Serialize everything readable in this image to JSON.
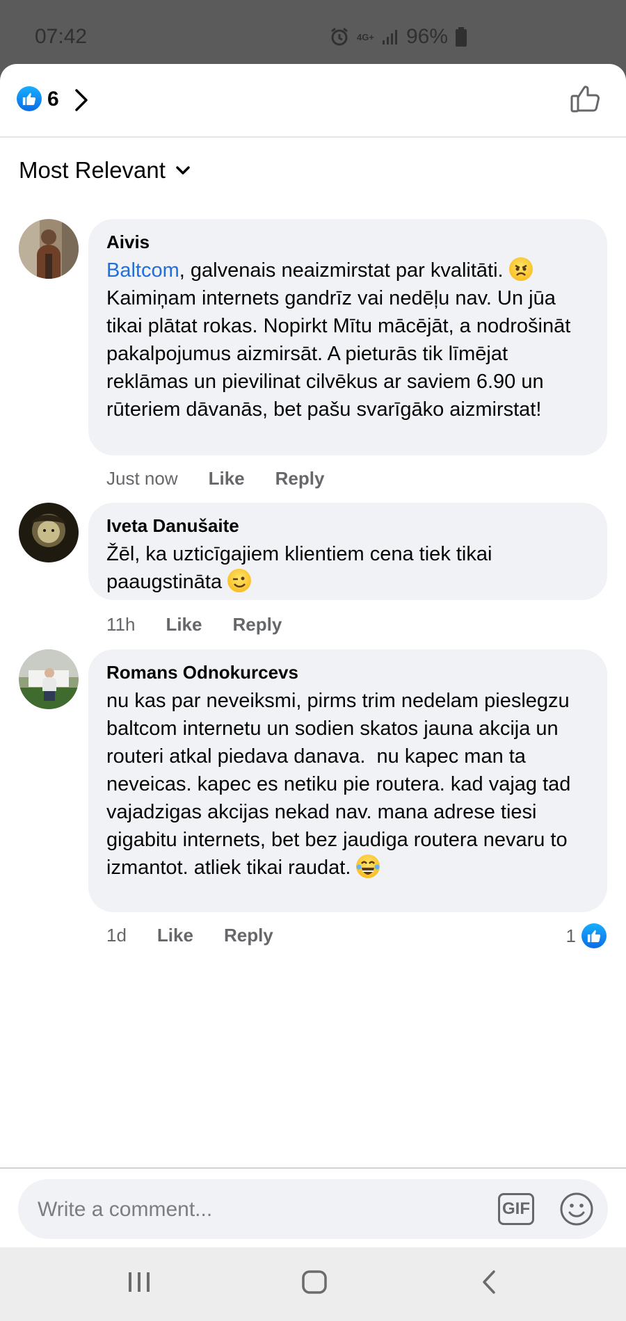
{
  "status_bar": {
    "time": "07:42",
    "network": "4G+",
    "battery": "96%"
  },
  "reactions": {
    "count": "6",
    "badge_icon": "thumbs-up-icon",
    "chevron_icon": "chevron-right-icon",
    "like_icon": "thumbs-up-outline-icon"
  },
  "sort": {
    "label": "Most Relevant",
    "icon": "chevron-down-icon"
  },
  "comments": [
    {
      "author": "Aivis",
      "mention": "Baltcom",
      "text": ", galvenais neaizmirstat par kvalitāti. ",
      "text_rest": "Kaimiņam internets gandrīz vai nedēļu nav. Un jūa tikai plātat rokas. Nopirkt Mītu mācējāt, a nodrošināt pakalpojumus aizmirsāt. A pieturās tik līmējat reklāmas un pievilinat cilvēkus ar saviem 6.90 un rūteriem dāvanās, bet pašu svarīgāko aizmirstat!",
      "emoji": "angry-face-emoji",
      "time": "Just now",
      "like_label": "Like",
      "reply_label": "Reply"
    },
    {
      "author": "Iveta Danušaite",
      "text": "Žēl, ka uzticīgajiem klientiem cena tiek tikai paaugstināta ",
      "emoji": "winking-face-emoji",
      "time": "11h",
      "like_label": "Like",
      "reply_label": "Reply"
    },
    {
      "author": "Romans Odnokurcevs",
      "text": "nu kas par neveiksmi, pirms trim nedelam pieslegzu baltcom internetu un sodien skatos jauna akcija un routeri atkal piedava danava.  nu kapec man ta neveicas. kapec es netiku pie routera. kad vajag tad vajadzigas akcijas nekad nav. mana adrese tiesi gigabitu internets, bet bez jaudiga routera nevaru to izmantot. atliek tikai raudat. ",
      "emoji": "tears-of-joy-emoji",
      "time": "1d",
      "like_label": "Like",
      "reply_label": "Reply",
      "reaction_count": "1"
    }
  ],
  "composer": {
    "placeholder": "Write a comment...",
    "gif_label": "GIF",
    "emoji_icon": "smiley-icon"
  },
  "nav_bar": {
    "icons": [
      "recent-apps-icon",
      "home-icon",
      "back-icon"
    ]
  },
  "colors": {
    "accent": "#216fdb",
    "bubble": "#f0f2f5",
    "meta": "#65676b",
    "like_blue": "#0a6ce8"
  }
}
